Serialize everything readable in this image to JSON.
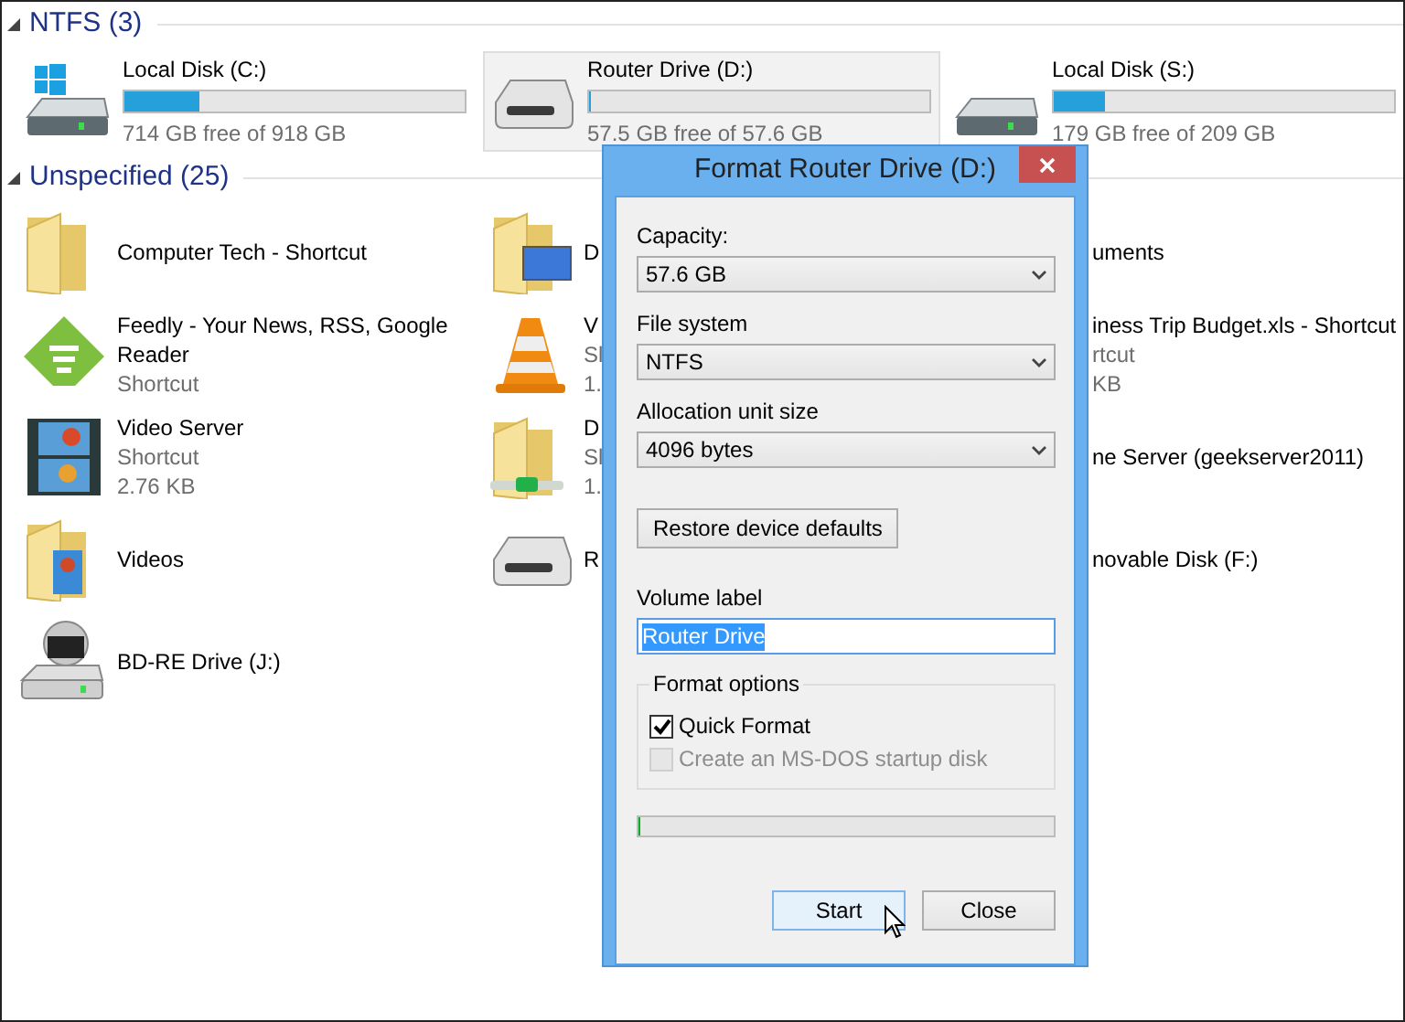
{
  "groups": [
    {
      "title": "NTFS (3)",
      "expanded": true,
      "drives": [
        {
          "kind": "windows-disk",
          "name": "Local Disk (C:)",
          "free": "714 GB free of 918 GB",
          "level": 0.22,
          "selected": false
        },
        {
          "kind": "removable",
          "name": "Router Drive (D:)",
          "free": "57.5 GB free of 57.6 GB",
          "level": 0,
          "selected": true
        },
        {
          "kind": "disk",
          "name": "Local Disk (S:)",
          "free": "179 GB free of 209 GB",
          "level": 0.15,
          "selected": false
        }
      ]
    },
    {
      "title": "Unspecified (25)",
      "expanded": true,
      "rows": [
        [
          {
            "kind": "folder",
            "lines": [
              "Computer Tech - Shortcut"
            ]
          },
          {
            "kind": "folder-monitor",
            "lines": [
              "D"
            ]
          },
          {
            "kind": "hidden",
            "lines": [
              "uments"
            ]
          }
        ],
        [
          {
            "kind": "feedly",
            "lines": [
              "Feedly - Your News, RSS, Google Reader",
              "Shortcut"
            ]
          },
          {
            "kind": "cone",
            "lines": [
              "V",
              "Sl",
              "1."
            ]
          },
          {
            "kind": "hidden",
            "lines": [
              "iness Trip Budget.xls - Shortcut",
              "rtcut",
              "KB"
            ]
          }
        ],
        [
          {
            "kind": "film",
            "lines": [
              "Video Server",
              "Shortcut",
              "2.76 KB"
            ]
          },
          {
            "kind": "network-folder",
            "lines": [
              "D",
              "Sl",
              "1."
            ]
          },
          {
            "kind": "hidden",
            "lines": [
              "ne Server (geekserver2011)"
            ]
          }
        ],
        [
          {
            "kind": "video-folder",
            "lines": [
              "Videos"
            ]
          },
          {
            "kind": "removable",
            "lines": [
              "R"
            ]
          },
          {
            "kind": "hidden",
            "lines": [
              "novable Disk (F:)"
            ]
          }
        ],
        [
          {
            "kind": "bd-drive",
            "lines": [
              "BD-RE Drive (J:)"
            ]
          }
        ]
      ]
    }
  ],
  "dialog": {
    "title": "Format Router Drive (D:)",
    "selects": [
      {
        "label": "Capacity:",
        "value": "57.6 GB"
      },
      {
        "label": "File system",
        "value": "NTFS"
      },
      {
        "label": "Allocation unit size",
        "value": "4096 bytes"
      }
    ],
    "restore_button": "Restore device defaults",
    "volume_label": {
      "label": "Volume label",
      "value": "Router Drive"
    },
    "format_options": {
      "title": "Format options",
      "options": [
        {
          "label": "Quick Format",
          "checked": true,
          "disabled": false
        },
        {
          "label": "Create an MS-DOS startup disk",
          "checked": false,
          "disabled": true
        }
      ]
    },
    "progress": {
      "level": 0
    },
    "buttons": [
      {
        "label": "Start",
        "focused": true
      },
      {
        "label": "Close",
        "focused": false
      }
    ]
  }
}
